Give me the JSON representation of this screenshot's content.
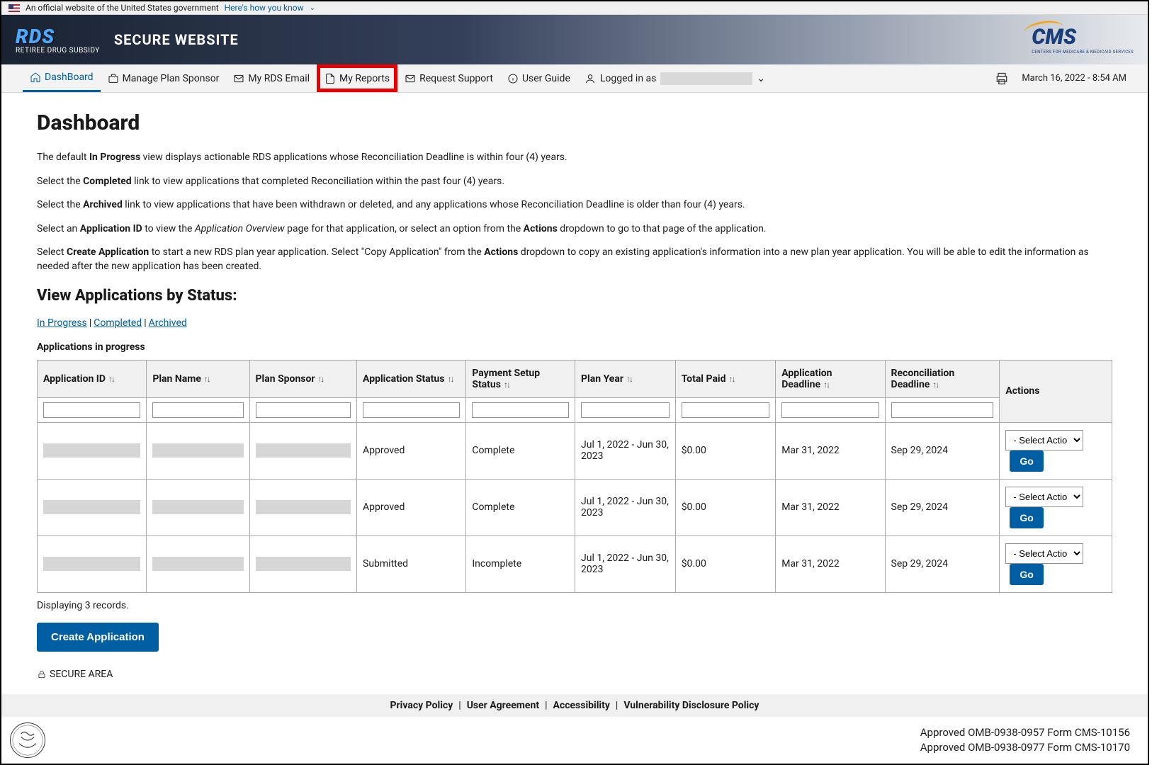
{
  "gov_banner": {
    "text": "An official website of the United States government",
    "link": "Here's how you know"
  },
  "header": {
    "logo_sub": "RETIREE DRUG SUBSIDY",
    "title": "SECURE WEBSITE",
    "cms_sub": "CENTERS FOR MEDICARE & MEDICAID SERVICES"
  },
  "nav": {
    "dashboard": "DashBoard",
    "manage": "Manage Plan Sponsor",
    "email": "My RDS Email",
    "reports": "My Reports",
    "support": "Request Support",
    "guide": "User Guide",
    "logged": "Logged in as",
    "datetime": "March 16, 2022 - 8:54 AM"
  },
  "page": {
    "title": "Dashboard",
    "p1a": "The default ",
    "p1b": "In Progress",
    "p1c": " view displays actionable RDS applications whose Reconciliation Deadline is within four (4) years.",
    "p2a": "Select the ",
    "p2b": "Completed",
    "p2c": " link to view applications that completed Reconciliation within the past four (4) years.",
    "p3a": "Select the ",
    "p3b": "Archived",
    "p3c": " link to view applications that have been withdrawn or deleted, and any applications whose Reconciliation Deadline is older than four (4) years.",
    "p4a": "Select an ",
    "p4b": "Application ID",
    "p4c": " to view the ",
    "p4d": "Application Overview",
    "p4e": " page for that application, or select an option from the ",
    "p4f": "Actions",
    "p4g": " dropdown to go to that page of the application.",
    "p5a": "Select ",
    "p5b": "Create Application",
    "p5c": " to start a new RDS plan year application. Select \"Copy Application\" from the ",
    "p5d": "Actions",
    "p5e": " dropdown to copy an existing application's information into a new plan year application. You will be able to edit the information as needed after the new application has been created.",
    "h2": "View Applications by Status:",
    "tab_inprogress": "In Progress",
    "tab_completed": "Completed",
    "tab_archived": "Archived",
    "table_title": "Applications in progress"
  },
  "table": {
    "headers": {
      "app_id": "Application ID",
      "plan_name": "Plan Name",
      "plan_sponsor": "Plan Sponsor",
      "app_status": "Application Status",
      "pay_status": "Payment Setup Status",
      "plan_year": "Plan Year",
      "total_paid": "Total Paid",
      "app_deadline": "Application Deadline",
      "rec_deadline": "Reconciliation Deadline",
      "actions": "Actions"
    },
    "rows": [
      {
        "app_status": "Approved",
        "pay_status": "Complete",
        "plan_year": "Jul 1, 2022 - Jun 30, 2023",
        "total_paid": "$0.00",
        "app_deadline": "Mar 31, 2022",
        "rec_deadline": "Sep 29, 2024"
      },
      {
        "app_status": "Approved",
        "pay_status": "Complete",
        "plan_year": "Jul 1, 2022 - Jun 30, 2023",
        "total_paid": "$0.00",
        "app_deadline": "Mar 31, 2022",
        "rec_deadline": "Sep 29, 2024"
      },
      {
        "app_status": "Submitted",
        "pay_status": "Incomplete",
        "plan_year": "Jul 1, 2022 - Jun 30, 2023",
        "total_paid": "$0.00",
        "app_deadline": "Mar 31, 2022",
        "rec_deadline": "Sep 29, 2024"
      }
    ],
    "action_placeholder": "- Select Action -",
    "go": "Go",
    "records": "Displaying 3 records.",
    "create": "Create Application"
  },
  "secure_area": "SECURE AREA",
  "footer": {
    "privacy": "Privacy Policy",
    "agreement": "User Agreement",
    "accessibility": "Accessibility",
    "vuln": "Vulnerability Disclosure Policy",
    "omb1": "Approved OMB-0938-0957 Form CMS-10156",
    "omb2": "Approved OMB-0938-0977 Form CMS-10170"
  }
}
